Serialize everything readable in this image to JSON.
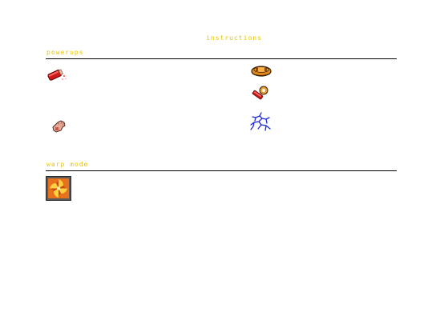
{
  "screen": {
    "title": "instructions"
  },
  "powerups": {
    "label": "powerups",
    "items": [
      {
        "icon": "red-dynamite-icon"
      },
      {
        "icon": "orange-shoe-icon"
      },
      {
        "icon": "red-key-icon"
      },
      {
        "icon": "pink-hand-icon"
      },
      {
        "icon": "blue-lightning-icon"
      }
    ]
  },
  "warp_mode": {
    "label": "warp mode",
    "icon": "warp-swirl-icon"
  },
  "colors": {
    "heading_text": "#e8c400",
    "rule": "#000000",
    "background": "#ffffff"
  }
}
